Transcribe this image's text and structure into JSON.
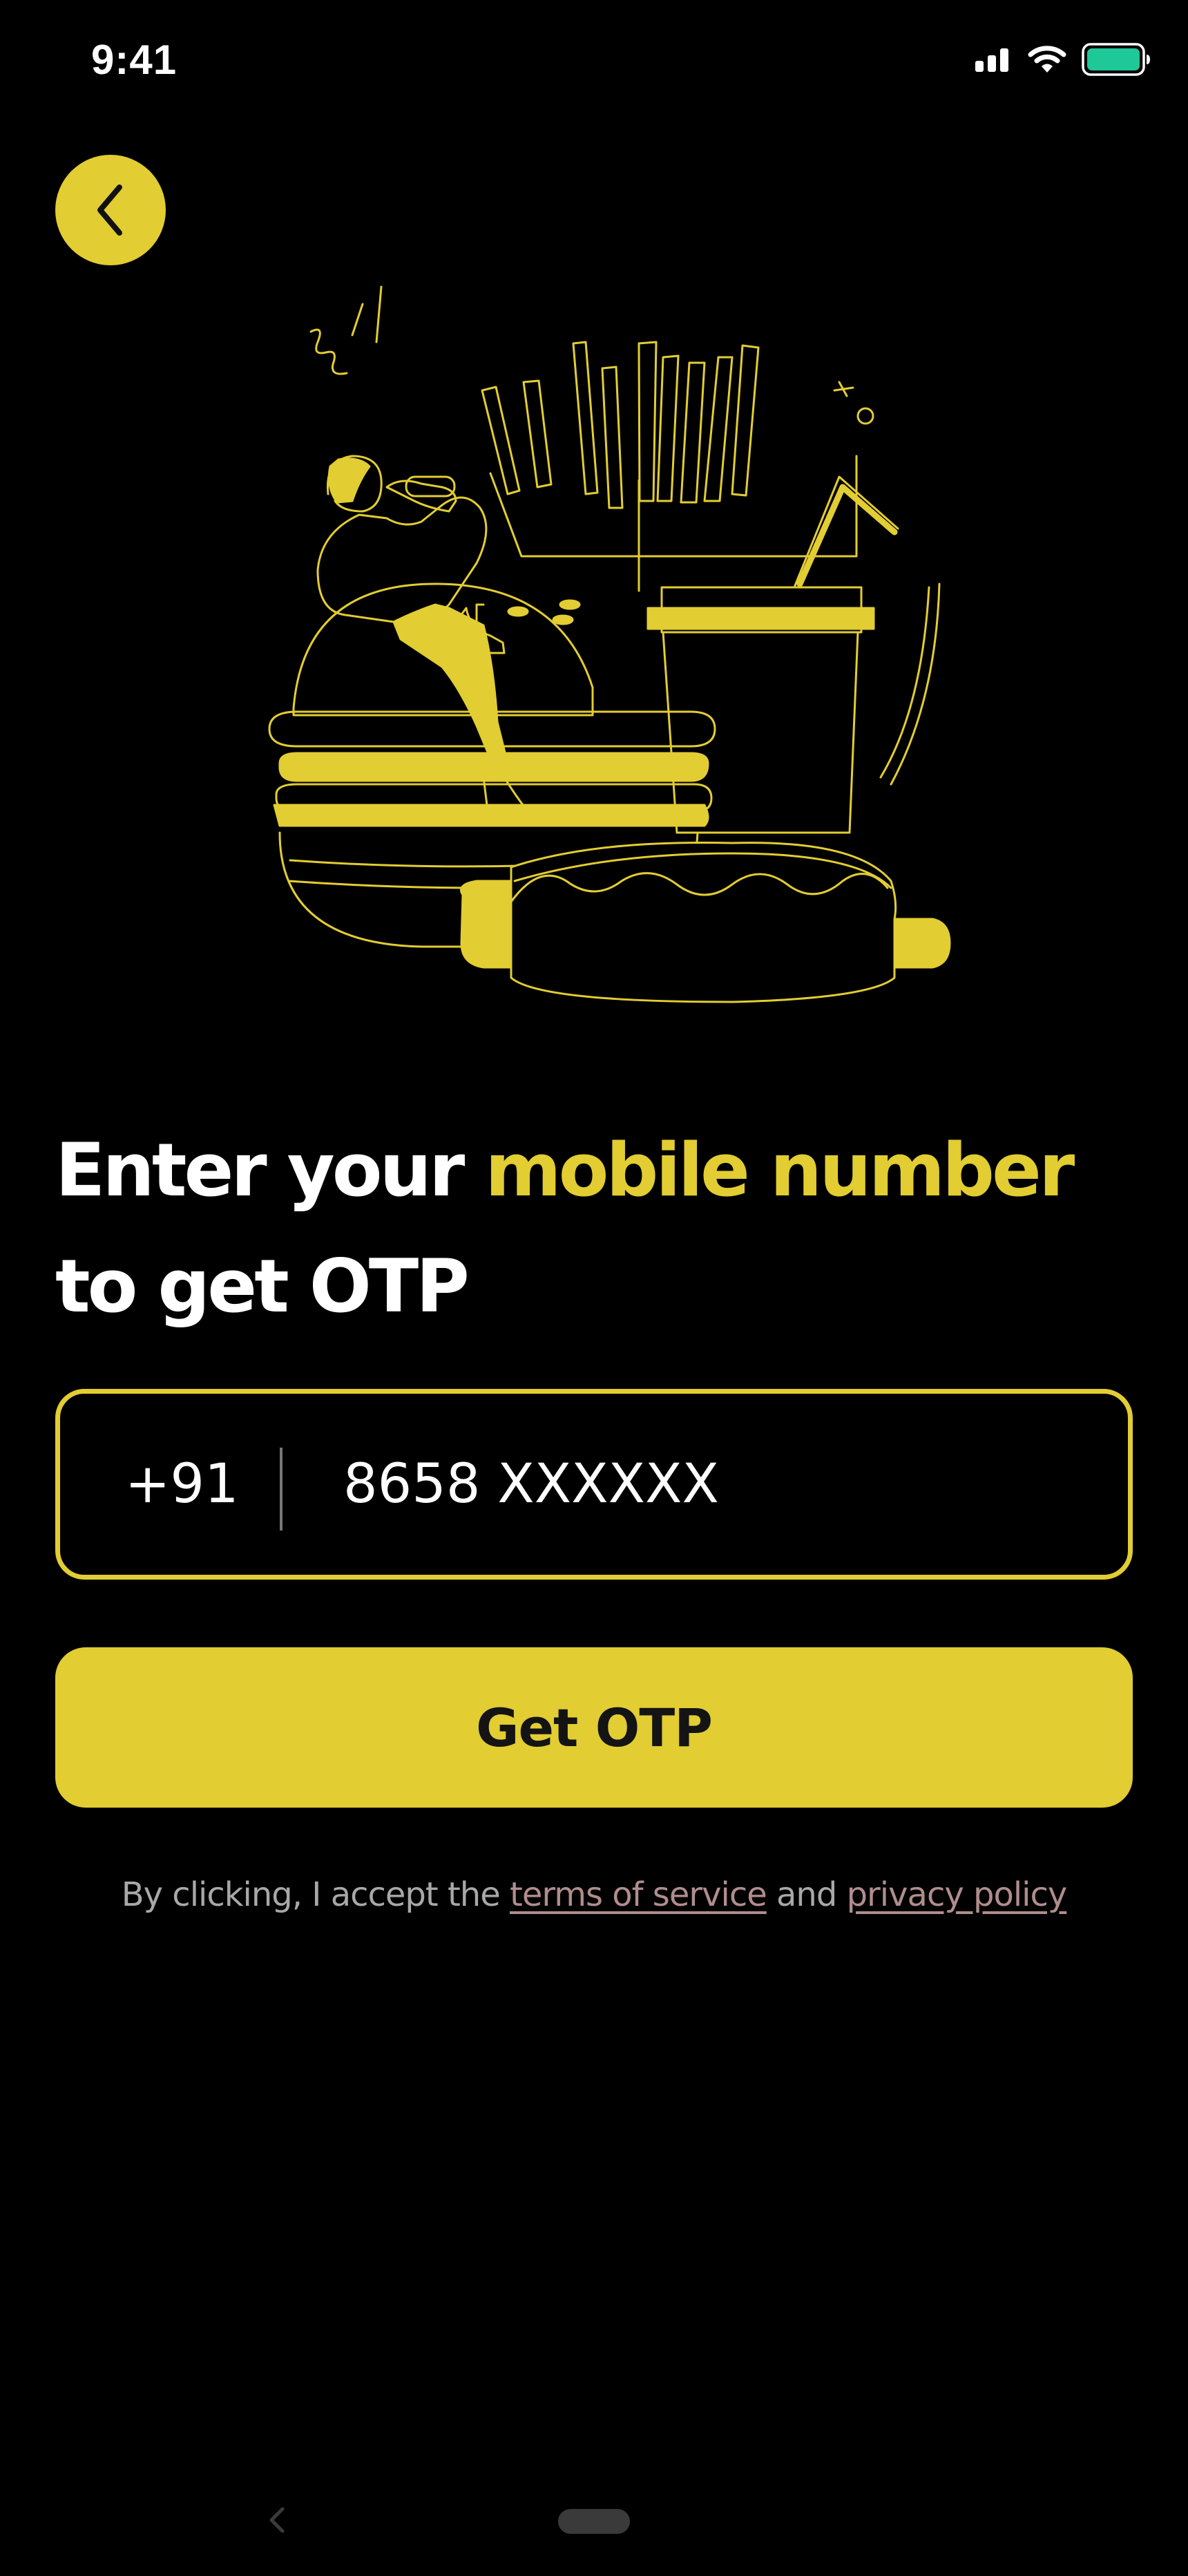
{
  "status_bar": {
    "time": "9:41",
    "icons": [
      "signal-icon",
      "wifi-icon",
      "battery-icon"
    ],
    "battery_color": "#1ec898"
  },
  "back_button": {
    "icon": "chevron-left-icon"
  },
  "illustration": {
    "subject": "food-illustration",
    "accent_color": "#e2cd32"
  },
  "headline": {
    "part1": "Enter your ",
    "accent": "mobile number",
    "part2": "to get OTP"
  },
  "phone": {
    "country_code": "+91",
    "value": "8658 XXXXXX",
    "placeholder": "8658 XXXXXX"
  },
  "otp_button": {
    "label": "Get OTP"
  },
  "terms": {
    "prefix": "By clicking, I accept the ",
    "terms_link": "terms of service",
    "middle": " and ",
    "privacy_link": "privacy policy"
  },
  "colors": {
    "background": "#000000",
    "accent": "#e2cd32",
    "link": "#b08d8d"
  }
}
